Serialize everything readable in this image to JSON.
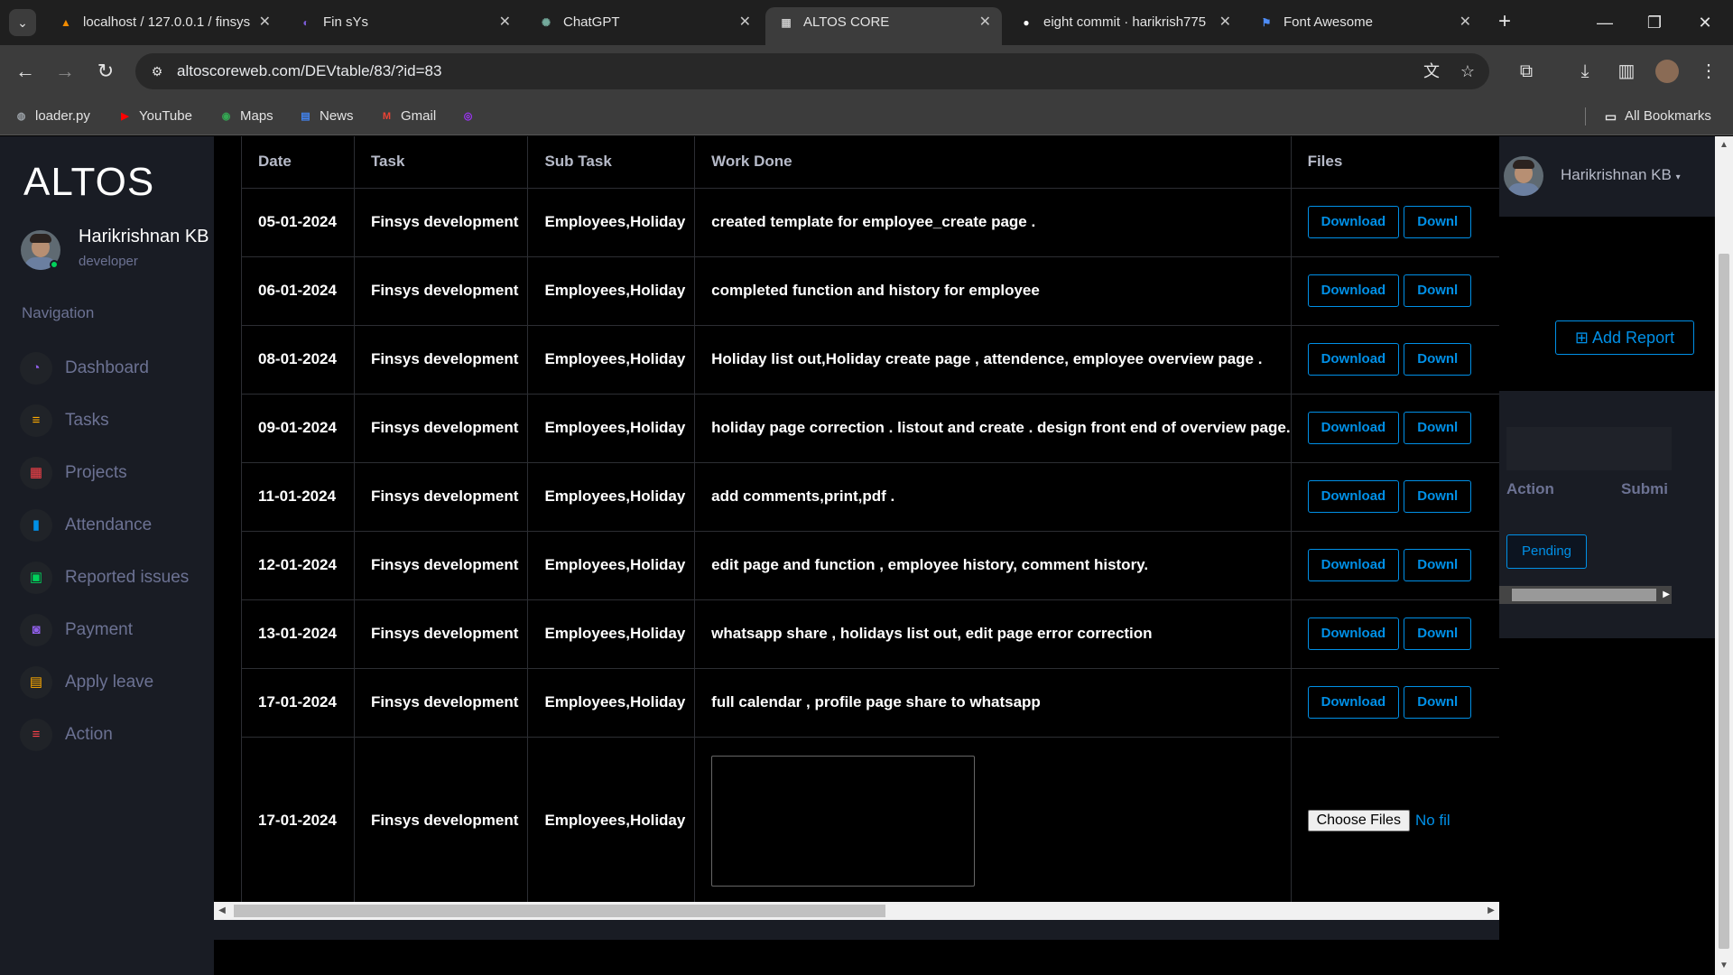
{
  "browser": {
    "tabs": [
      {
        "title": "localhost / 127.0.0.1 / finsys",
        "icon": "phpmyadmin-icon",
        "color": "#f28c00",
        "active": false
      },
      {
        "title": "Fin sYs",
        "icon": "finsys-icon",
        "color": "#7b5cd6",
        "active": false
      },
      {
        "title": "ChatGPT",
        "icon": "chatgpt-icon",
        "color": "#74aa9c",
        "active": false
      },
      {
        "title": "ALTOS CORE",
        "icon": "altos-icon",
        "color": "#c7c7c7",
        "active": true
      },
      {
        "title": "eight commit · harikrish775",
        "icon": "github-icon",
        "color": "#ffffff",
        "active": false
      },
      {
        "title": "Font Awesome",
        "icon": "flag-icon",
        "color": "#4e8cf5",
        "active": false
      }
    ],
    "url": "altoscoreweb.com/DEVtable/83/?id=83",
    "bookmarks": [
      {
        "label": "loader.py",
        "icon": "globe-icon",
        "color": "#9aa0a6"
      },
      {
        "label": "YouTube",
        "icon": "youtube-icon",
        "color": "#ff0000"
      },
      {
        "label": "Maps",
        "icon": "maps-icon",
        "color": "#34a853"
      },
      {
        "label": "News",
        "icon": "news-icon",
        "color": "#4285f4"
      },
      {
        "label": "Gmail",
        "icon": "gmail-icon",
        "color": "#ea4335"
      },
      {
        "label": "",
        "icon": "messenger-icon",
        "color": "#a033ff"
      }
    ],
    "all_bookmarks": "All Bookmarks"
  },
  "sidebar": {
    "brand": "ALTOS",
    "user_name": "Harikrishnan KB",
    "user_role": "developer",
    "nav_heading": "Navigation",
    "items": [
      {
        "label": "Dashboard",
        "icon": "speedometer-icon",
        "color": "#8f5fe8"
      },
      {
        "label": "Tasks",
        "icon": "tasks-icon",
        "color": "#ffab00"
      },
      {
        "label": "Projects",
        "icon": "grid-icon",
        "color": "#fc424a"
      },
      {
        "label": "Attendance",
        "icon": "bar-chart-icon",
        "color": "#0090e7"
      },
      {
        "label": "Reported issues",
        "icon": "report-icon",
        "color": "#00d25b"
      },
      {
        "label": "Payment",
        "icon": "payment-icon",
        "color": "#8f5fe8"
      },
      {
        "label": "Apply leave",
        "icon": "leave-icon",
        "color": "#ffab00"
      },
      {
        "label": "Action",
        "icon": "action-icon",
        "color": "#fc424a"
      }
    ]
  },
  "table": {
    "headers": [
      "Date",
      "Task",
      "Sub Task",
      "Work Done",
      "Files"
    ],
    "download_label": "Download",
    "download_label_cut": "Downl",
    "rows": [
      {
        "date": "05-01-2024",
        "task": "Finsys development",
        "sub_task": "Employees,Holiday",
        "work": "created template for employee_create page ."
      },
      {
        "date": "06-01-2024",
        "task": "Finsys development",
        "sub_task": "Employees,Holiday",
        "work": "completed function and history for employee"
      },
      {
        "date": "08-01-2024",
        "task": "Finsys development",
        "sub_task": "Employees,Holiday",
        "work": "Holiday list out,Holiday create page , attendence, employee overview page ."
      },
      {
        "date": "09-01-2024",
        "task": "Finsys development",
        "sub_task": "Employees,Holiday",
        "work": "holiday page correction . listout and create . design front end of overview page."
      },
      {
        "date": "11-01-2024",
        "task": "Finsys development",
        "sub_task": "Employees,Holiday",
        "work": "add comments,print,pdf ."
      },
      {
        "date": "12-01-2024",
        "task": "Finsys development",
        "sub_task": "Employees,Holiday",
        "work": "edit page and function , employee history, comment history."
      },
      {
        "date": "13-01-2024",
        "task": "Finsys development",
        "sub_task": "Employees,Holiday",
        "work": "whatsapp share , holidays list out, edit page error correction"
      },
      {
        "date": "17-01-2024",
        "task": "Finsys development",
        "sub_task": "Employees,Holiday",
        "work": "full calendar , profile page share to whatsapp"
      }
    ],
    "input_row": {
      "date": "17-01-2024",
      "task": "Finsys development",
      "sub_task": "Employees,Holiday",
      "work_value": "",
      "choose_files": "Choose Files",
      "no_file": "No fil"
    }
  },
  "right_pane": {
    "user_name": "Harikrishnan KB",
    "add_report": "Add Report",
    "col_action": "Action",
    "col_submit": "Submi",
    "status": "Pending"
  }
}
